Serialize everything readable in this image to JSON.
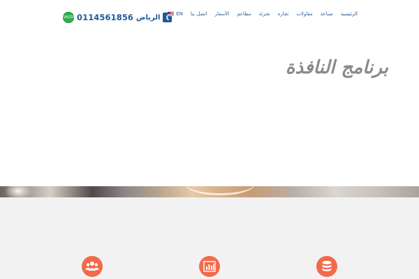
{
  "header": {
    "phone_number": "0114561856",
    "city": "الرياض",
    "nav": [
      {
        "label": "الرئيسية"
      },
      {
        "label": "صناعة"
      },
      {
        "label": "مقاولات"
      },
      {
        "label": "تجارة"
      },
      {
        "label": "تجزئة"
      },
      {
        "label": "مطاعم"
      },
      {
        "label": "الأسعار"
      },
      {
        "label": "اتصل بنا"
      }
    ],
    "language": "EN",
    "badge_text": "SAUDI"
  },
  "hero": {
    "title": "برنامج النافذة"
  },
  "features": {
    "icons": [
      "users-icon",
      "chart-icon",
      "database-icon"
    ]
  },
  "colors": {
    "brand_blue": "#1e5a99",
    "accent_orange": "#f26a4b",
    "saudi_green": "#2bb24c"
  }
}
